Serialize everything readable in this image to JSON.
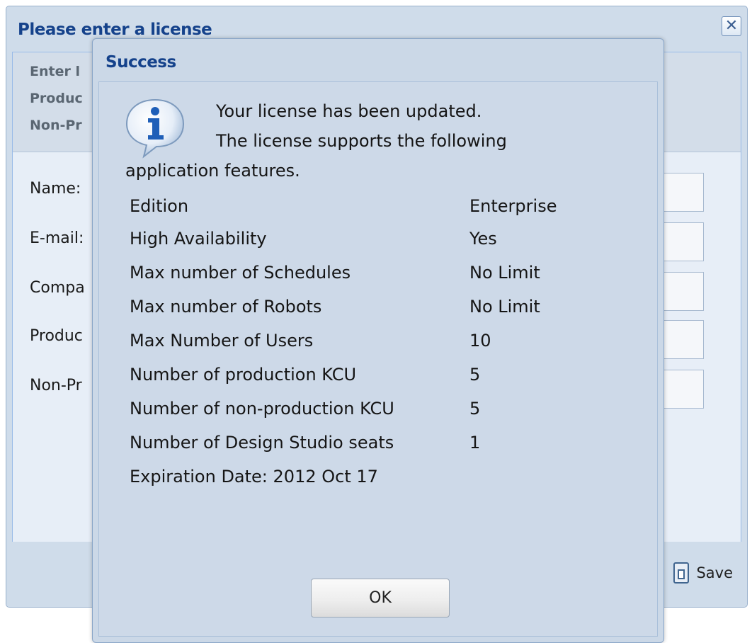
{
  "license_window": {
    "title": "Please enter a license",
    "close_icon": "close-icon",
    "instructions": [
      "Enter l",
      "Produc",
      "Non-Pr"
    ],
    "fields": [
      {
        "label": "Name:"
      },
      {
        "label": "E-mail:"
      },
      {
        "label": "Compa"
      },
      {
        "label": "Produc"
      },
      {
        "label": "Non-Pr"
      }
    ],
    "save_label": "Save",
    "save_icon": "save-icon"
  },
  "dialog": {
    "title": "Success",
    "icon": "info-icon",
    "message_line1": "Your license has been updated.",
    "message_line2": "The license supports the following",
    "message_line3": "application features.",
    "features": [
      {
        "name": "Edition",
        "value": "Enterprise"
      },
      {
        "name": "High Availability",
        "value": "Yes"
      },
      {
        "name": "Max number of Schedules",
        "value": "No Limit"
      },
      {
        "name": "Max number of Robots",
        "value": "No Limit"
      },
      {
        "name": "Max Number of Users",
        "value": "10"
      },
      {
        "name": "Number of production KCU",
        "value": "5"
      },
      {
        "name": "Number of non-production KCU",
        "value": "5"
      },
      {
        "name": "Number of Design Studio seats",
        "value": "1"
      }
    ],
    "expiration": "Expiration Date: 2012 Oct 17",
    "ok_label": "OK"
  },
  "colors": {
    "title_text": "#15428b",
    "window_bg": "#cfdcea",
    "dialog_bg": "#cbd8e7",
    "info_icon_blue": "#1f5fb8"
  }
}
